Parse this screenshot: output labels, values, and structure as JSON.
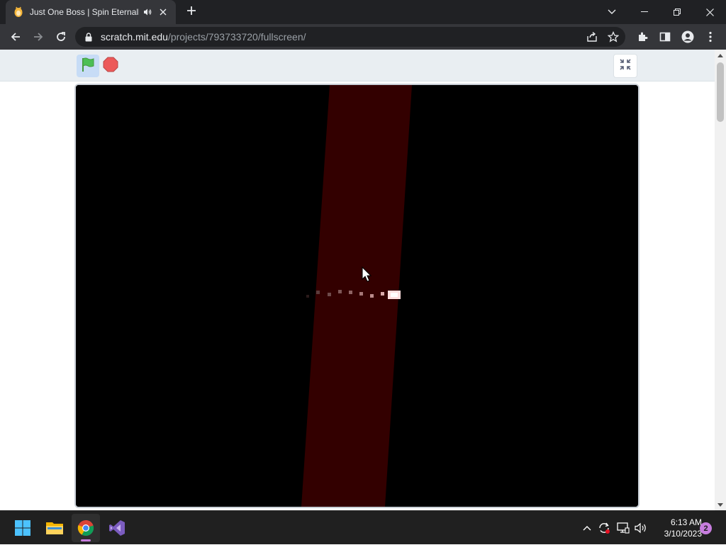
{
  "browser": {
    "tab": {
      "title": "Just One Boss | Spin Eternally",
      "favicon": "scratch-cat-icon",
      "audio_icon": "speaker-playing-icon"
    },
    "url": {
      "host": "scratch.mit.edu",
      "path": "/projects/793733720/fullscreen/"
    },
    "toolbar_icons": [
      "back-arrow-icon",
      "forward-arrow-icon",
      "reload-icon",
      "lock-icon",
      "share-icon",
      "star-icon",
      "extensions-icon",
      "side-panel-icon",
      "profile-icon",
      "menu-icon"
    ],
    "window_icons": [
      "tab-search-icon",
      "minimize-icon",
      "restore-icon",
      "close-icon"
    ]
  },
  "scratch": {
    "controls": [
      "green-flag-icon",
      "stop-icon",
      "exit-fullscreen-icon"
    ],
    "colors": {
      "menu_bar": "#e9eef2",
      "flag": "#4cbf56",
      "stop": "#ec5959",
      "stage_bg": "#000000",
      "beam": "#330000"
    }
  },
  "taskbar": {
    "apps": [
      "windows-start-icon",
      "file-explorer-icon",
      "chrome-icon",
      "visual-studio-icon"
    ],
    "tray_icons": [
      "chevron-up-icon",
      "sync-icon",
      "display-icon",
      "volume-icon"
    ],
    "time": "6:13 AM",
    "date": "3/10/2023",
    "notification_count": "2"
  }
}
